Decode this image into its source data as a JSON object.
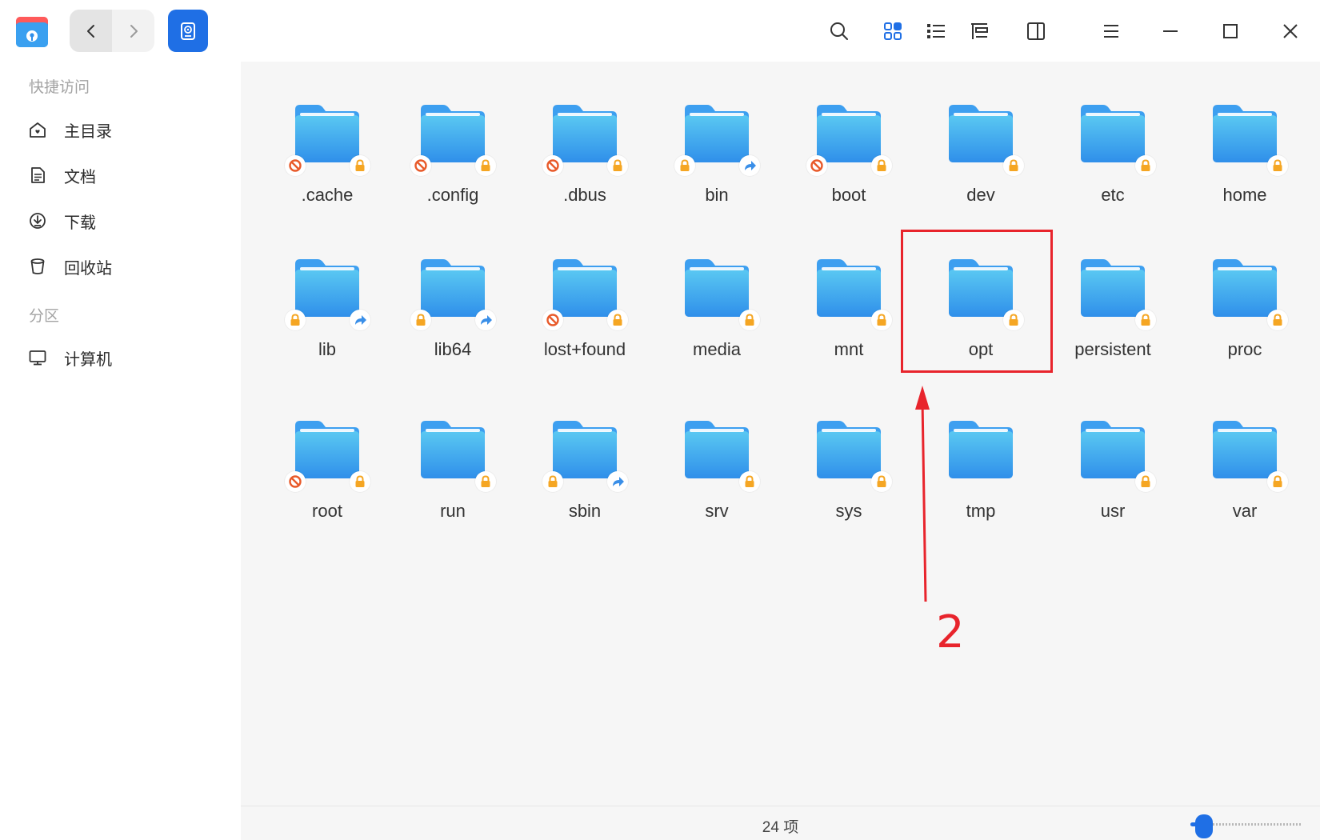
{
  "titlebar": {
    "app_icon": "file-manager-icon",
    "back_icon": "chevron-left-icon",
    "forward_icon": "chevron-right-icon",
    "location_icon": "system-disk-icon",
    "tools": [
      "search-icon",
      "icon-view-icon",
      "list-view-icon",
      "tree-view-icon",
      "detail-panel-icon",
      "menu-icon",
      "minimize-icon",
      "maximize-icon",
      "close-icon"
    ]
  },
  "sidebar": {
    "quick_access_heading": "快捷访问",
    "items": [
      {
        "label": "主目录",
        "icon": "home-icon"
      },
      {
        "label": "文档",
        "icon": "document-icon"
      },
      {
        "label": "下载",
        "icon": "download-icon"
      },
      {
        "label": "回收站",
        "icon": "trash-icon"
      }
    ],
    "partitions_heading": "分区",
    "partition_items": [
      {
        "label": "计算机",
        "icon": "computer-icon"
      }
    ]
  },
  "folders": [
    {
      "name": ".cache",
      "badges": [
        "no-access",
        "lock"
      ]
    },
    {
      "name": ".config",
      "badges": [
        "no-access",
        "lock"
      ]
    },
    {
      "name": ".dbus",
      "badges": [
        "no-access",
        "lock"
      ]
    },
    {
      "name": "bin",
      "badges": [
        "lock",
        "symlink"
      ]
    },
    {
      "name": "boot",
      "badges": [
        "no-access",
        "lock"
      ]
    },
    {
      "name": "dev",
      "badges": [
        "lock"
      ]
    },
    {
      "name": "etc",
      "badges": [
        "lock"
      ]
    },
    {
      "name": "home",
      "badges": [
        "lock"
      ]
    },
    {
      "name": "lib",
      "badges": [
        "lock",
        "symlink"
      ]
    },
    {
      "name": "lib64",
      "badges": [
        "lock",
        "symlink"
      ]
    },
    {
      "name": "lost+found",
      "badges": [
        "no-access",
        "lock"
      ]
    },
    {
      "name": "media",
      "badges": [
        "lock"
      ]
    },
    {
      "name": "mnt",
      "badges": [
        "lock"
      ]
    },
    {
      "name": "opt",
      "badges": [
        "lock"
      ]
    },
    {
      "name": "persistent",
      "badges": [
        "lock"
      ]
    },
    {
      "name": "proc",
      "badges": [
        "lock"
      ]
    },
    {
      "name": "root",
      "badges": [
        "no-access",
        "lock"
      ]
    },
    {
      "name": "run",
      "badges": [
        "lock"
      ]
    },
    {
      "name": "sbin",
      "badges": [
        "lock",
        "symlink"
      ]
    },
    {
      "name": "srv",
      "badges": [
        "lock"
      ]
    },
    {
      "name": "sys",
      "badges": [
        "lock"
      ]
    },
    {
      "name": "tmp",
      "badges": []
    },
    {
      "name": "usr",
      "badges": [
        "lock"
      ]
    },
    {
      "name": "var",
      "badges": [
        "lock"
      ]
    }
  ],
  "status": {
    "item_count": "24 项",
    "zoom_level": 0.12
  },
  "annotation": {
    "number": "2",
    "target_folder": "opt",
    "color": "#e8242c"
  },
  "colors": {
    "accent": "#1f6fe5",
    "folder_top": "#5ac8f2",
    "folder_bottom": "#2f8fea",
    "lock_badge": "#f5a623",
    "no_access_badge": "#e85a2a"
  }
}
